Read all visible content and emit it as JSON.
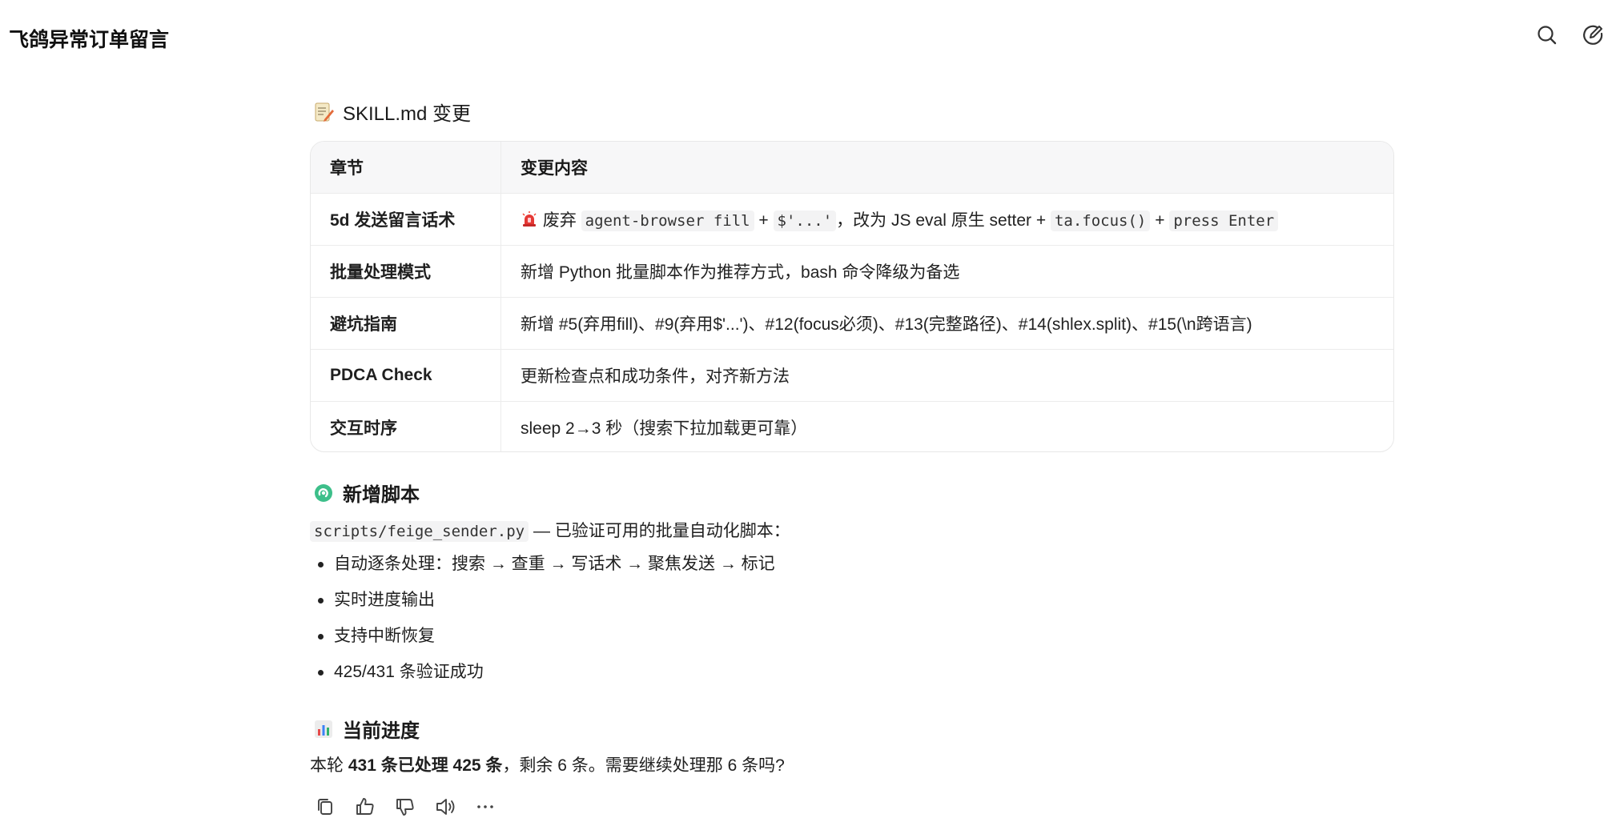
{
  "header": {
    "title": "飞鸽异常订单留言",
    "icons": [
      "search-icon",
      "new-chat-icon"
    ]
  },
  "section_skill": {
    "emoji": "memo-icon",
    "title": "SKILL.md 变更"
  },
  "table": {
    "headers": [
      "章节",
      "变更内容"
    ],
    "rows": [
      {
        "section": "5d 发送留言话术",
        "change": {
          "emoji": "siren-icon",
          "t1": " 废弃 ",
          "code1": "agent-browser fill",
          "t2": " + ",
          "code2": "$'...'",
          "t3": "，改为 JS eval 原生 setter + ",
          "code3": "ta.focus()",
          "t4": " + ",
          "code4": "press Enter"
        }
      },
      {
        "section": "批量处理模式",
        "change_text": "新增 Python 批量脚本作为推荐方式，bash 命令降级为备选"
      },
      {
        "section": "避坑指南",
        "change_text": "新增 #5(弃用fill)、#9(弃用$'...')、#12(focus必须)、#13(完整路径)、#14(shlex.split)、#15(\\n跨语言)"
      },
      {
        "section": "PDCA Check",
        "change_text": "更新检查点和成功条件，对齐新方法"
      },
      {
        "section": "交互时序",
        "change_text": "sleep 2→3 秒（搜索下拉加载更可靠）"
      }
    ]
  },
  "section_script": {
    "emoji": "new-icon",
    "title": "新增脚本",
    "path": "scripts/feige_sender.py",
    "desc": " — 已验证可用的批量自动化脚本：",
    "bullets": [
      "自动逐条处理：搜索 → 查重 → 写话术 → 聚焦发送 → 标记",
      "实时进度输出",
      "支持中断恢复",
      "425/431 条验证成功"
    ]
  },
  "section_progress": {
    "emoji": "bar-chart-icon",
    "title": "当前进度",
    "p1": "本轮 ",
    "p2": "431 条已处理 425 条",
    "p3": "，剩余 6 条。需要继续处理那 6 条吗?"
  },
  "actions": [
    "copy-icon",
    "thumbs-up-icon",
    "thumbs-down-icon",
    "speaker-icon",
    "more-icon"
  ]
}
